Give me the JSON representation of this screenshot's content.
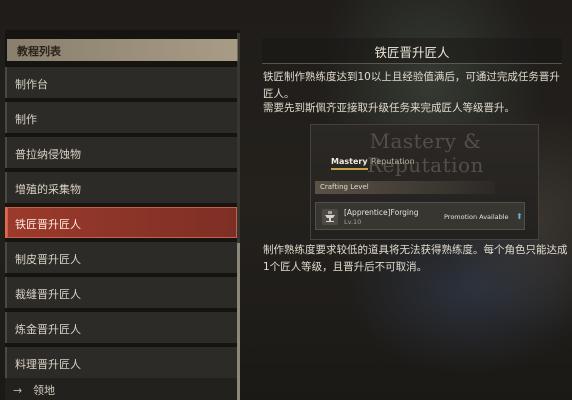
{
  "list": {
    "header": "教程列表",
    "items": [
      {
        "label": "制作台",
        "selected": false
      },
      {
        "label": "制作",
        "selected": false
      },
      {
        "label": "普拉纳侵蚀物",
        "selected": false
      },
      {
        "label": "增殖的采集物",
        "selected": false
      },
      {
        "label": "铁匠晋升匠人",
        "selected": true
      },
      {
        "label": "制皮晋升匠人",
        "selected": false
      },
      {
        "label": "裁缝晋升匠人",
        "selected": false
      },
      {
        "label": "炼金晋升匠人",
        "selected": false
      },
      {
        "label": "料理晋升匠人",
        "selected": false
      }
    ],
    "footer": {
      "icon": "arrow-right-icon",
      "label": "领地"
    }
  },
  "detail": {
    "title": "铁匠晋升匠人",
    "desc1": "铁匠制作熟练度达到10以上且经验值满后，可通过完成任务晋升匠人。",
    "desc2": "需要先到斯佩齐亚接取升级任务来完成匠人等级晋升。",
    "desc3": "制作熟练度要求较低的道具将无法获得熟练度。每个角色只能达成1个匠人等级，且晋升后不可取消。"
  },
  "mastery_image": {
    "title": "Mastery & Reputation",
    "tabs": [
      "Mastery",
      "Reputation"
    ],
    "active_tab": "Mastery",
    "section": "Crafting Level",
    "row": {
      "name": "[Apprentice]Forging",
      "level": "Lv.10",
      "status": "Promotion Available",
      "status_icon": "up-arrow-icon"
    }
  },
  "colors": {
    "selected_bg": "#9b3a2c",
    "header_bg": "#a89c86",
    "accent": "#c9a14a"
  }
}
